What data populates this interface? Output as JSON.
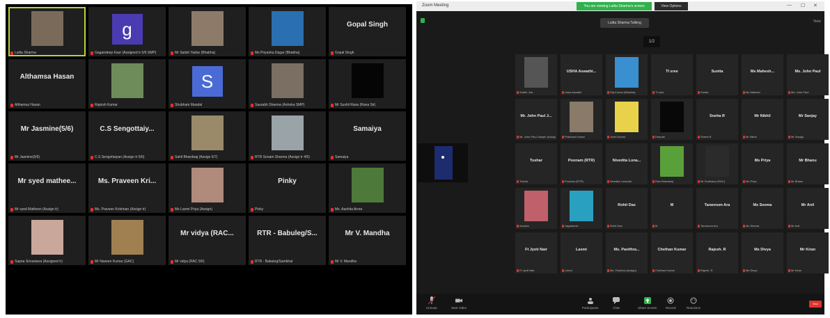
{
  "left_gallery": {
    "tiles": [
      {
        "big": "",
        "label": "Lalita Sharma",
        "kind": "photo",
        "color": "#7a6a5a",
        "active": true
      },
      {
        "big": "g",
        "label": "Gagandeep Kaur (Assigned tr 5/6 SMP)",
        "kind": "initial",
        "color": "#4a3bb3"
      },
      {
        "big": "",
        "label": "Mr Satish Yadav (Bhabha)",
        "kind": "photo",
        "color": "#8d7b6a"
      },
      {
        "big": "",
        "label": "Ms Priyanka Dagar (Bhabha)",
        "kind": "photo",
        "color": "#2a6fb0"
      },
      {
        "big": "Gopal Singh",
        "label": "Gopal Singh",
        "kind": "name"
      },
      {
        "big": "Althamsa Hasan",
        "label": "Althamsa Hasan",
        "kind": "name"
      },
      {
        "big": "",
        "label": "Rajnish Kumar",
        "kind": "photo",
        "color": "#6d8c5a"
      },
      {
        "big": "S",
        "label": "Shubham Mandal",
        "kind": "initial",
        "color": "#4a6bd6"
      },
      {
        "big": "",
        "label": "Saurabh Sharma (Ashoka SMP)",
        "kind": "photo",
        "color": "#7b6f63"
      },
      {
        "big": "",
        "label": "Mr Sushil Rana (Rana Sir)",
        "kind": "photo",
        "color": "#050505"
      },
      {
        "big": "Mr Jasmine(5/6)",
        "label": "Mr Jasmine(5/6)",
        "kind": "name"
      },
      {
        "big": "C.S Sengottaiy...",
        "label": "C.S Sengottaiyan (Assign tr 5/6)",
        "kind": "name"
      },
      {
        "big": "",
        "label": "Sahil Bhardwaj (Assign 6/7)",
        "kind": "photo",
        "color": "#9a8a6a"
      },
      {
        "big": "",
        "label": "RTR Sonam Sharma (Assign tr 4/5)",
        "kind": "photo",
        "color": "#9aa4a8"
      },
      {
        "big": "Samaiya",
        "label": "Samaiya",
        "kind": "name"
      },
      {
        "big": "Mr syed mathee...",
        "label": "Mr syed Matheen (Assign tr)",
        "kind": "name"
      },
      {
        "big": "Ms. Praveen Kri...",
        "label": "Ms. Praveen Krishnan (Assign tr)",
        "kind": "name"
      },
      {
        "big": "",
        "label": "Ms Laxmi Priya (Assign)",
        "kind": "photo",
        "color": "#b08a7a"
      },
      {
        "big": "Pinky",
        "label": "Pinky",
        "kind": "name"
      },
      {
        "big": "",
        "label": "Ms. Aashita Arora",
        "kind": "photo",
        "color": "#4d7a3a"
      },
      {
        "big": "",
        "label": "Sapna Srivastava (Assigned tr)",
        "kind": "photo",
        "color": "#c9a79a"
      },
      {
        "big": "",
        "label": "Mr Naveen Kumar (GAC)",
        "kind": "photo",
        "color": "#a08050"
      },
      {
        "big": "Mr vidya (RAC...",
        "label": "Mr vidya (RAC 5/6)",
        "kind": "name"
      },
      {
        "big": "RTR - Babuleg/S...",
        "label": "RTR - Babuleg/Sambhal",
        "kind": "name"
      },
      {
        "big": "Mr V. Mandha",
        "label": "Mr V. Mandha",
        "kind": "name"
      }
    ]
  },
  "right_window": {
    "title": "Zoom Meeting",
    "notice": "You are viewing Lalita Sharma's screen",
    "view_options": "View Options",
    "speaking": "Lalita Sharma Talking",
    "view": "View",
    "page_up": "1/2",
    "tiles": [
      {
        "big": "",
        "label": "Sudhir Jha",
        "kind": "photo",
        "color": "#555"
      },
      {
        "big": "USHA Aswathi...",
        "label": "Usha Aswathi",
        "kind": "name"
      },
      {
        "big": "",
        "label": "Raj Kumar (Bhabha)",
        "kind": "photo",
        "color": "#3a8fd0"
      },
      {
        "big": "TI sree",
        "label": "TI sree",
        "kind": "name"
      },
      {
        "big": "Sunita",
        "label": "Sunita",
        "kind": "name"
      },
      {
        "big": "Ms Mahesh...",
        "label": "Ms Mahesh",
        "kind": "name"
      },
      {
        "big": "Ms. John Paul",
        "label": "Ms. John Paul",
        "kind": "name"
      },
      {
        "big": "Mr. John Paul J...",
        "label": "Mr. John Paul Joseph (Assign)",
        "kind": "name"
      },
      {
        "big": "",
        "label": "Prashant Kumar",
        "kind": "photo",
        "color": "#8a7a6a"
      },
      {
        "big": "",
        "label": "Joshi Kumar",
        "kind": "photo",
        "color": "#e8d24a"
      },
      {
        "big": "",
        "label": "Deepak",
        "kind": "photo",
        "color": "#080808"
      },
      {
        "big": "Sneha R",
        "label": "Sneha R",
        "kind": "name"
      },
      {
        "big": "Mr Nikhil",
        "label": "Mr Nikhil",
        "kind": "name"
      },
      {
        "big": "Mr Sanjay",
        "label": "Mr Sanjay",
        "kind": "name"
      },
      {
        "big": "Tushar",
        "label": "Tushar",
        "kind": "name"
      },
      {
        "big": "Poonam (RTR)",
        "label": "Poonam (RTR)",
        "kind": "name"
      },
      {
        "big": "Nivedita Lona...",
        "label": "Nivedita Lonandh",
        "kind": "name"
      },
      {
        "big": "",
        "label": "Ravi Bhardwaj",
        "kind": "photo",
        "color": "#5aa03a"
      },
      {
        "big": "",
        "label": "Mr Sudhakar (RAC)",
        "kind": "photo",
        "color": "#2b2b2b"
      },
      {
        "big": "Ms Priya",
        "label": "Ms Priya",
        "kind": "name"
      },
      {
        "big": "Mr Bhanu",
        "label": "Mr Bhanu",
        "kind": "name"
      },
      {
        "big": "",
        "label": "Anusha",
        "kind": "photo",
        "color": "#c0606a"
      },
      {
        "big": "",
        "label": "Jagadeesh",
        "kind": "photo",
        "color": "#2aa0c0"
      },
      {
        "big": "Rohit Das",
        "label": "Rohit Das",
        "kind": "name"
      },
      {
        "big": "M",
        "label": "M",
        "kind": "name"
      },
      {
        "big": "Tarannum Ara",
        "label": "Tarannum Ara",
        "kind": "name"
      },
      {
        "big": "Ms Seema",
        "label": "Ms Seema",
        "kind": "name"
      },
      {
        "big": "Mr Anil",
        "label": "Mr Anil",
        "kind": "name"
      },
      {
        "big": "Ft Jyoti Nair",
        "label": "Ft Jyoti Nair",
        "kind": "name"
      },
      {
        "big": "Laxmi",
        "label": "Laxmi",
        "kind": "name"
      },
      {
        "big": "Ms. Pavithra...",
        "label": "Ms. Pavithra (Assign)",
        "kind": "name"
      },
      {
        "big": "Chethan Kumar",
        "label": "Chethan Kumar",
        "kind": "name"
      },
      {
        "big": "Rajesh. R",
        "label": "Rajesh. R",
        "kind": "name"
      },
      {
        "big": "Ms Divya",
        "label": "Ms Divya",
        "kind": "name"
      },
      {
        "big": "Mr Kiran",
        "label": "Mr Kiran",
        "kind": "name"
      }
    ],
    "toolbar": {
      "unmute": "Unmute",
      "start_video": "Start Video",
      "participants": "Participants",
      "chat": "Chat",
      "share_screen": "Share Screen",
      "record": "Record",
      "reactions": "Reactions",
      "end": "End"
    }
  },
  "colors": {
    "mic_muted": "#e0332f",
    "share_green": "#2fb24c",
    "active_border": "#b8d43a"
  }
}
